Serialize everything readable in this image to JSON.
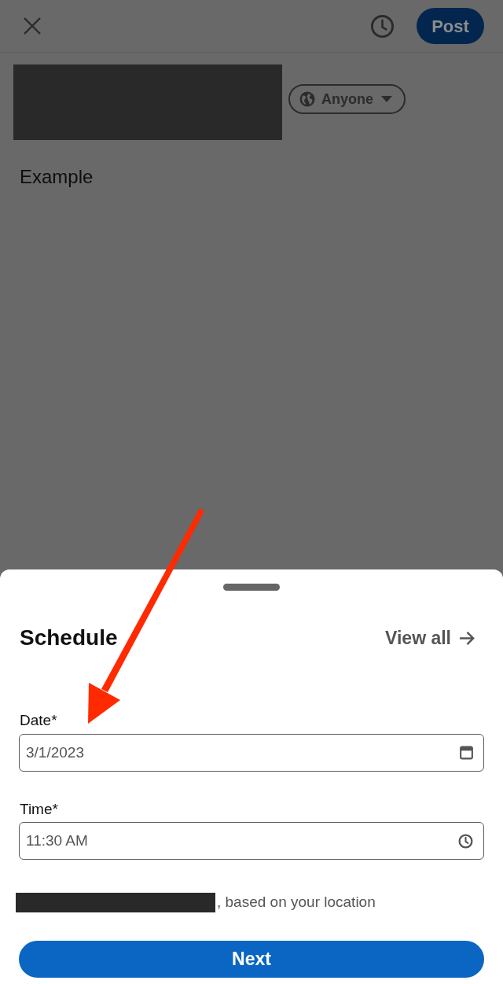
{
  "top_bar": {
    "post_button": "Post"
  },
  "author": {
    "visibility": "Anyone"
  },
  "post": {
    "text": "Example"
  },
  "schedule_sheet": {
    "title": "Schedule",
    "view_all": "View all",
    "fields": [
      {
        "kind": "date",
        "label": "Date*",
        "value": "3/1/2023"
      },
      {
        "kind": "time",
        "label": "Time*",
        "value": "11:30 AM"
      }
    ],
    "location_note": ", based on your location",
    "next_button": "Next"
  }
}
